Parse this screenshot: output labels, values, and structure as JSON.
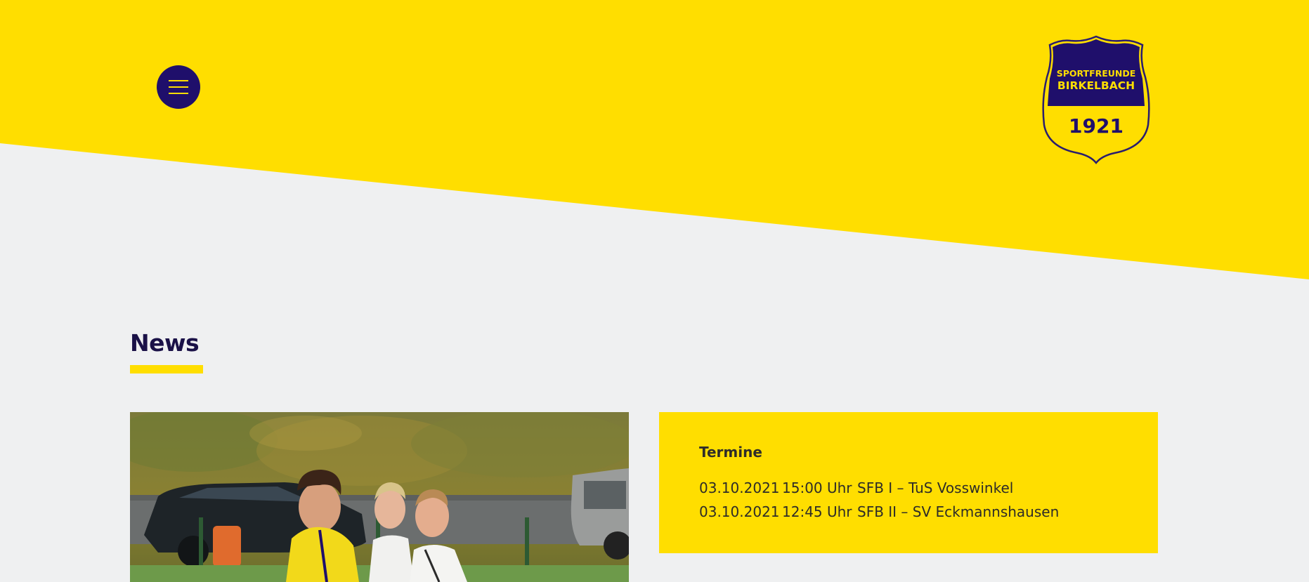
{
  "colors": {
    "brand_yellow": "#ffde00",
    "brand_navy": "#1f0f6b",
    "background": "#eff0f1",
    "heading_text": "#1a1147"
  },
  "header": {
    "menu_icon": "hamburger-icon",
    "logo": {
      "line1": "SPORTFREUNDE",
      "line2": "BIRKELBACH",
      "year": "1921"
    }
  },
  "news": {
    "title": "News"
  },
  "termine": {
    "title": "Termine",
    "events": [
      {
        "date": "03.10.2021",
        "time": "15:00 Uhr",
        "match": "SFB I – TuS Vosswinkel"
      },
      {
        "date": "03.10.2021",
        "time": "12:45 Uhr",
        "match": "SFB II – SV Eckmannshausen"
      }
    ]
  }
}
